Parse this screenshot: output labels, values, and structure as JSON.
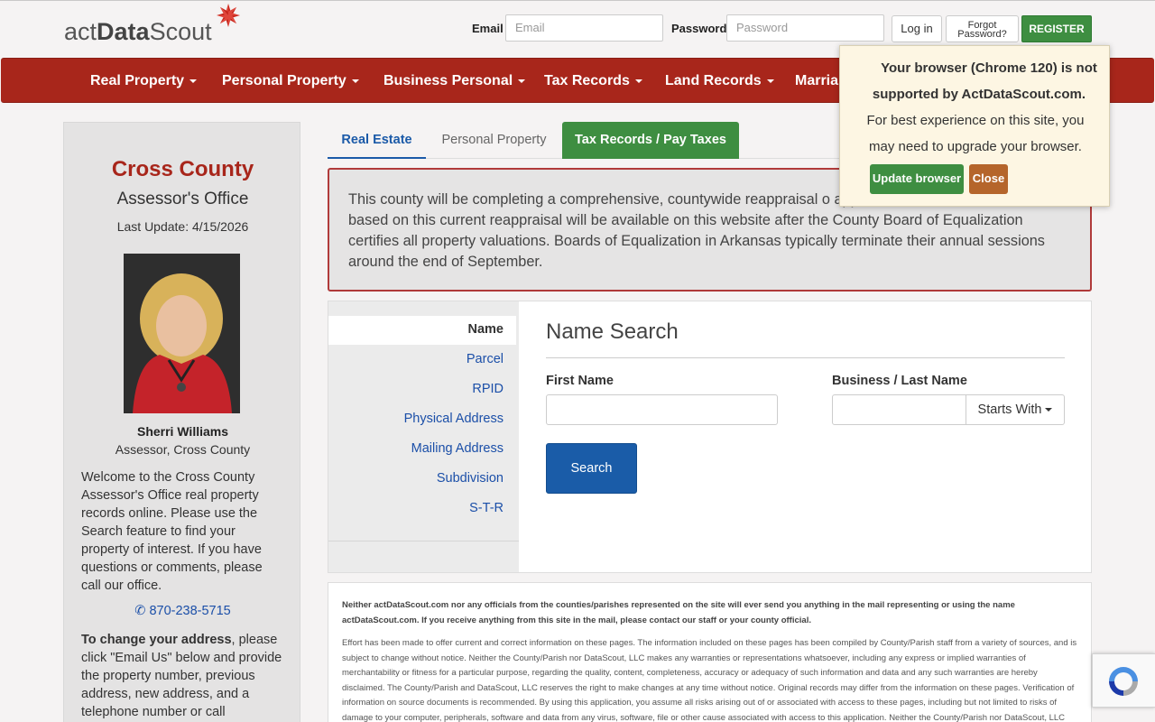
{
  "header": {
    "logo_text_light": "act",
    "logo_text_bold": "Data",
    "logo_text_end": "Scout",
    "email_label": "Email",
    "email_placeholder": "Email",
    "password_label": "Password",
    "password_placeholder": "Password",
    "login_label": "Log in",
    "forgot_line1": "Forgot",
    "forgot_line2": "Password?",
    "register_label": "REGISTER"
  },
  "nav": {
    "items": [
      {
        "label": "Real Property"
      },
      {
        "label": "Personal Property"
      },
      {
        "label": "Business Personal"
      },
      {
        "label": "Tax Records"
      },
      {
        "label": "Land Records"
      },
      {
        "label": "Marria"
      }
    ]
  },
  "sidebar": {
    "county": "Cross County",
    "office": "Assessor's Office",
    "last_update": "Last Update: 4/15/2026",
    "person_name": "Sherri Williams",
    "person_title": "Assessor, Cross County",
    "welcome": "Welcome to the Cross County Assessor's Office real property records online. Please use the Search feature to find your property of interest. If you have questions or comments, please call our office.",
    "phone": "870-238-5715",
    "change_bold": "To change your address",
    "change_rest": ", please click \"Email Us\" below and provide the property number, previous address, new address, and a telephone number or call"
  },
  "tabs": {
    "real_estate": "Real Estate",
    "personal_property": "Personal Property",
    "tax_records": "Tax Records / Pay Taxes"
  },
  "alert": {
    "text": "This county will be completing a comprehensive, countywide reappraisal o appraised and assessed values based on this current reappraisal will be available on this website after the County Board of Equalization certifies all property valuations. Boards of Equalization in Arkansas typically terminate their annual sessions around the end of September."
  },
  "search": {
    "nav_items": [
      "Name",
      "Parcel",
      "RPID",
      "Physical Address",
      "Mailing Address",
      "Subdivision",
      "S-T-R"
    ],
    "title": "Name Search",
    "first_name_label": "First Name",
    "last_name_label": "Business / Last Name",
    "starts_with": "Starts With",
    "search_button": "Search"
  },
  "disclaimer": {
    "bold": "Neither actDataScout.com nor any officials from the counties/parishes represented on the site will ever send you anything in the mail representing or using the name actDataScout.com. If you receive anything from this site in the mail, please contact our staff or your county official.",
    "body": "Effort has been made to offer current and correct information on these pages. The information included on these pages has been compiled by County/Parish staff from a variety of sources, and is subject to change without notice. Neither the County/Parish nor DataScout, LLC makes any warranties or representations whatsoever, including any express or implied warranties of merchantability or fitness for a particular purpose, regarding the quality, content, completeness, accuracy or adequacy of such information and data and any such warranties are hereby disclaimed. The County/Parish and DataScout, LLC reserves the right to make changes at any time without notice. Original records may differ from the information on these pages. Verification of information on source documents is recommended. By using this application, you assume all risks arising out of or associated with access to these pages, including but not limited to risks of damage to your computer, peripherals, software and data from any virus, software, file or other cause associated with access to this application. Neither the County/Parish nor DataScout, LLC"
  },
  "popup": {
    "line1": "Your browser (Chrome 120) is not",
    "line2": "supported by ActDataScout.com.",
    "line3": "For best experience on this site, you",
    "line4": "may need to upgrade your browser.",
    "update_label": "Update browser",
    "close_label": "Close"
  },
  "colors": {
    "brand_red": "#a8261b",
    "green": "#3e8e41",
    "blue_link": "#1b4fa8",
    "button_blue": "#1a5ca8",
    "close_brown": "#b5652b"
  }
}
